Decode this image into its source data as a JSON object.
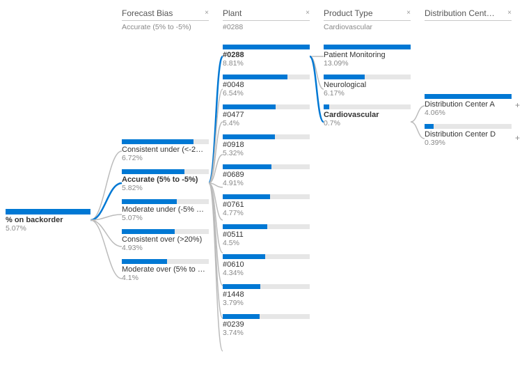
{
  "chart_data": {
    "type": "bar",
    "title": "Decomposition tree — % on backorder",
    "root": {
      "label": "% on backorder",
      "value": 5.07,
      "bar_pct": 100
    },
    "levels": [
      {
        "name": "Forecast Bias",
        "selected": "Accurate (5% to -5%)",
        "items": [
          {
            "label": "Consistent under (<-2…",
            "value": 6.72,
            "bar_pct": 82,
            "bold": false
          },
          {
            "label": "Accurate (5% to -5%)",
            "value": 5.82,
            "bar_pct": 72,
            "bold": true
          },
          {
            "label": "Moderate under (-5% …",
            "value": 5.07,
            "bar_pct": 63,
            "bold": false
          },
          {
            "label": "Consistent over (>20%)",
            "value": 4.93,
            "bar_pct": 61,
            "bold": false
          },
          {
            "label": "Moderate over (5% to …",
            "value": 4.1,
            "bar_pct": 52,
            "bold": false
          }
        ]
      },
      {
        "name": "Plant",
        "selected": "#0288",
        "items": [
          {
            "label": "#0288",
            "value": 8.81,
            "bar_pct": 100,
            "bold": true
          },
          {
            "label": "#0048",
            "value": 6.54,
            "bar_pct": 74,
            "bold": false
          },
          {
            "label": "#0477",
            "value": 5.4,
            "bar_pct": 61,
            "bold": false
          },
          {
            "label": "#0918",
            "value": 5.32,
            "bar_pct": 60,
            "bold": false
          },
          {
            "label": "#0689",
            "value": 4.91,
            "bar_pct": 56,
            "bold": false
          },
          {
            "label": "#0761",
            "value": 4.77,
            "bar_pct": 54,
            "bold": false
          },
          {
            "label": "#0511",
            "value": 4.5,
            "bar_pct": 51,
            "bold": false
          },
          {
            "label": "#0610",
            "value": 4.34,
            "bar_pct": 49,
            "bold": false
          },
          {
            "label": "#1448",
            "value": 3.79,
            "bar_pct": 43,
            "bold": false
          },
          {
            "label": "#0239",
            "value": 3.74,
            "bar_pct": 42,
            "bold": false
          }
        ]
      },
      {
        "name": "Product Type",
        "selected": "Cardiovascular",
        "items": [
          {
            "label": "Patient Monitoring",
            "value": 13.09,
            "bar_pct": 100,
            "bold": false
          },
          {
            "label": "Neurological",
            "value": 6.17,
            "bar_pct": 47,
            "bold": false
          },
          {
            "label": "Cardiovascular",
            "value": 0.7,
            "bar_pct": 6,
            "bold": true
          }
        ]
      },
      {
        "name": "Distribution Cent…",
        "selected": null,
        "items": [
          {
            "label": "Distribution Center A",
            "value": 4.06,
            "bar_pct": 100,
            "bold": false
          },
          {
            "label": "Distribution Center D",
            "value": 0.39,
            "bar_pct": 10,
            "bold": false
          }
        ]
      }
    ]
  },
  "expand_glyph": "+",
  "close_glyph": "×"
}
